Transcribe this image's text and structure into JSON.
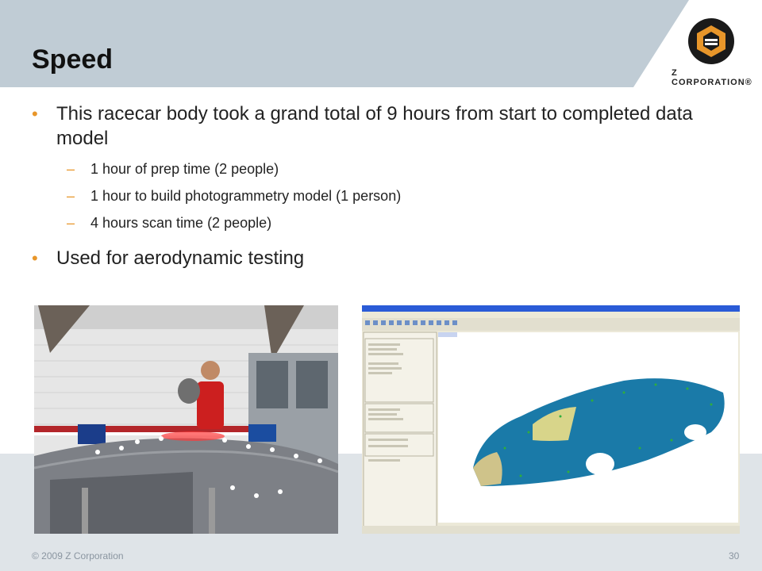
{
  "slide": {
    "title": "Speed",
    "logo_text": "Z CORPORATION®",
    "bullets": [
      {
        "text": "This racecar body took a grand total of 9 hours from start to completed data model",
        "sub": [
          "1 hour of prep time (2 people)",
          "1 hour to build photogrammetry model (1 person)",
          "4 hours scan time (2 people)"
        ]
      },
      {
        "text": "Used for aerodynamic testing"
      }
    ],
    "footer_left": "© 2009 Z Corporation",
    "page_number": "30"
  },
  "colors": {
    "header_band": "#c0ccd5",
    "bullet_accent": "#e8962a",
    "logo_orange": "#e8962a",
    "car_blue": "#1a7aa8"
  },
  "images": {
    "left_photo": "man-scanning-racecar-photo",
    "right_screenshot": "geomagic-software-car-model-screenshot"
  }
}
